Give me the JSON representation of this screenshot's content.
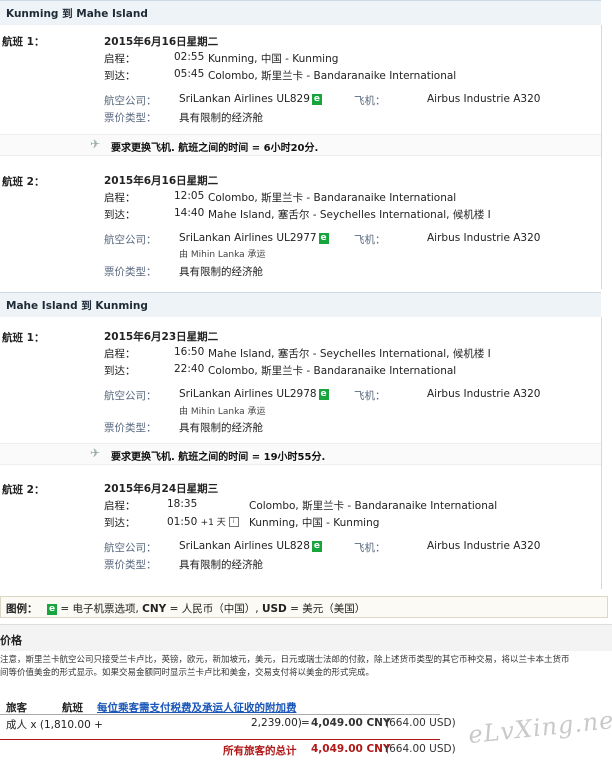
{
  "sections": [
    {
      "header": "Kunming 到 Mahe Island",
      "flights": [
        {
          "label": "航班 1：",
          "date": "2015年6月16日星期二",
          "depart_label": "启程：",
          "depart_time": "02:55",
          "depart_place": "Kunming, 中国 - Kunming",
          "arrive_label": "到达：",
          "arrive_time": "05:45",
          "arrive_place": "Colombo, 斯里兰卡 - Bandaranaike International",
          "airline_label": "航空公司：",
          "airline": "SriLankan Airlines UL829",
          "eticket": "e",
          "aircraft_label": "飞机：",
          "aircraft": "Airbus Industrie A320",
          "fare_label": "票价类型：",
          "fare": "具有限制的经济舱"
        },
        {
          "label": "航班 2：",
          "date": "2015年6月16日星期二",
          "depart_label": "启程：",
          "depart_time": "12:05",
          "depart_place": "Colombo, 斯里兰卡 - Bandaranaike International",
          "arrive_label": "到达：",
          "arrive_time": "14:40",
          "arrive_place": "Mahe Island, 塞舌尔 - Seychelles International, 候机楼 I",
          "airline_label": "航空公司：",
          "airline": "SriLankan Airlines UL2977",
          "eticket": "e",
          "operated_by": "由 Mihin Lanka 承运",
          "aircraft_label": "飞机：",
          "aircraft": "Airbus Industrie A320",
          "fare_label": "票价类型：",
          "fare": "具有限制的经济舱"
        }
      ],
      "layover": "要求更换飞机. 航班之间的时间 = 6小时20分."
    },
    {
      "header": "Mahe Island 到 Kunming",
      "flights": [
        {
          "label": "航班 1：",
          "date": "2015年6月23日星期二",
          "depart_label": "启程：",
          "depart_time": "16:50",
          "depart_place": "Mahe Island, 塞舌尔 - Seychelles International, 候机楼 I",
          "arrive_label": "到达：",
          "arrive_time": "22:40",
          "arrive_place": "Colombo, 斯里兰卡 - Bandaranaike International",
          "airline_label": "航空公司：",
          "airline": "SriLankan Airlines UL2978",
          "eticket": "e",
          "operated_by": "由 Mihin Lanka 承运",
          "aircraft_label": "飞机：",
          "aircraft": "Airbus Industrie A320",
          "fare_label": "票价类型：",
          "fare": "具有限制的经济舱"
        },
        {
          "label": "航班 2：",
          "date": "2015年6月24日星期三",
          "depart_label": "启程：",
          "depart_time": "18:35",
          "depart_place": "Colombo, 斯里兰卡 - Bandaranaike International",
          "arrive_label": "到达：",
          "arrive_time": "01:50",
          "arrive_plus": "+1 天",
          "arrive_place": "Kunming, 中国 - Kunming",
          "airline_label": "航空公司：",
          "airline": "SriLankan Airlines UL828",
          "eticket": "e",
          "aircraft_label": "飞机：",
          "aircraft": "Airbus Industrie A320",
          "fare_label": "票价类型：",
          "fare": "具有限制的经济舱"
        }
      ],
      "layover": "要求更换飞机. 航班之间的时间 = 19小时55分."
    }
  ],
  "legend": {
    "label": "图例：",
    "e_text": "= 电子机票选项,",
    "cny_code": "CNY",
    "cny_text": "= 人民币（中国）,",
    "usd_code": "USD",
    "usd_text": "= 美元（美国）"
  },
  "price": {
    "header": "价格",
    "note_line1": "注意，斯里兰卡航空公司只接受兰卡卢比，英镑，欧元，新加坡元，美元，日元或瑞士法郎的付款，除上述货币类型的其它币种交易，将以兰卡本土货币",
    "note_line2": "间等价值美金的形式显示。如果交易金额同时显示兰卡卢比和美金，交易支付将以美金的形式完成。",
    "col_passenger": "旅客",
    "col_flight": "航班",
    "fees_link": "每位乘客需支付税费及承运人征收的附加费",
    "row_passenger": "成人 x (1,810.00 +",
    "row_fees": "2,239.00)",
    "row_eq": "=",
    "row_total": "4,049.00 CNY",
    "row_usd": "(664.00 USD)",
    "grand_label": "所有旅客的总计",
    "grand_total": "4,049.00 CNY",
    "grand_usd": "(664.00 USD)"
  },
  "watermark": "eLvXing.net"
}
